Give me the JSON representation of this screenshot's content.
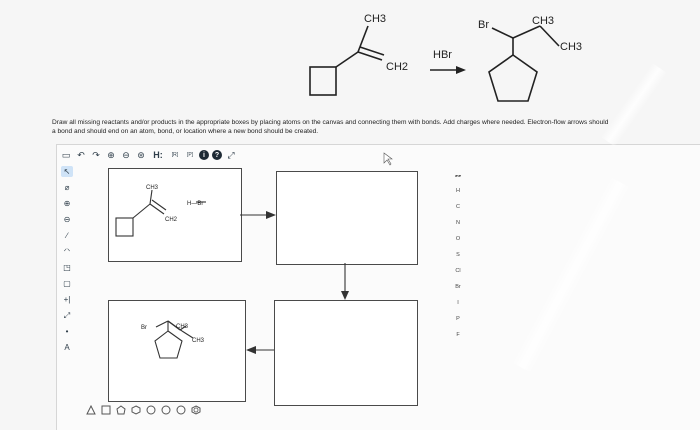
{
  "reaction": {
    "reactant_ch3": "CH3",
    "reactant_ch2": "CH2",
    "reagent": "HBr",
    "product_br": "Br",
    "product_ch3_top": "CH3",
    "product_ch3_right": "CH3"
  },
  "instructions": {
    "line1": "Draw all missing reactants and/or products in the appropriate boxes by placing atoms on the canvas and connecting them with bonds. Add charges where needed. Electron-flow arrows should",
    "line2": "a bond and should end on an atom, bond, or location where a new bond should be created."
  },
  "toolbar": {
    "items": [
      "new-doc",
      "undo",
      "redo",
      "zoom-in",
      "zoom-out",
      "zoom-fit",
      "H:",
      "templates",
      "templates-2",
      "info",
      "help",
      "expand"
    ],
    "h_label": "H:",
    "template_label_1": "[R]",
    "template_label_2": "[P]"
  },
  "left_tools": [
    "select",
    "erase",
    "charge-plus",
    "charge-minus",
    "bond",
    "chain",
    "ring",
    "atom",
    "lasso",
    "arrow",
    "text",
    "atom-label"
  ],
  "left_tool_glyphs": {
    "select": "↖",
    "erase": "⌀",
    "charge_plus": "⊕",
    "charge_minus": "⊖",
    "bond": "∕",
    "chain": "ᐟᐠ",
    "ring": "◳",
    "atom": "▢",
    "lasso": "+|",
    "arrow": "⤢",
    "text": "•",
    "atom_label": "A"
  },
  "elements": [
    "H",
    "C",
    "N",
    "O",
    "S",
    "Cl",
    "Br",
    "I",
    "P",
    "F"
  ],
  "canvas": {
    "box1": {
      "ch3": "CH3",
      "ch2": "CH2",
      "hbr": "H—Br"
    },
    "box4": {
      "br": "Br",
      "ch3_top": "CH3",
      "ch3_right": "CH3"
    },
    "br_lone_pairs": ":Br:"
  },
  "colors": {
    "line": "#222222",
    "box_border": "#4a4a4a",
    "toolbar_icon": "#2f3e4a",
    "selected": "#cfe3f7"
  }
}
